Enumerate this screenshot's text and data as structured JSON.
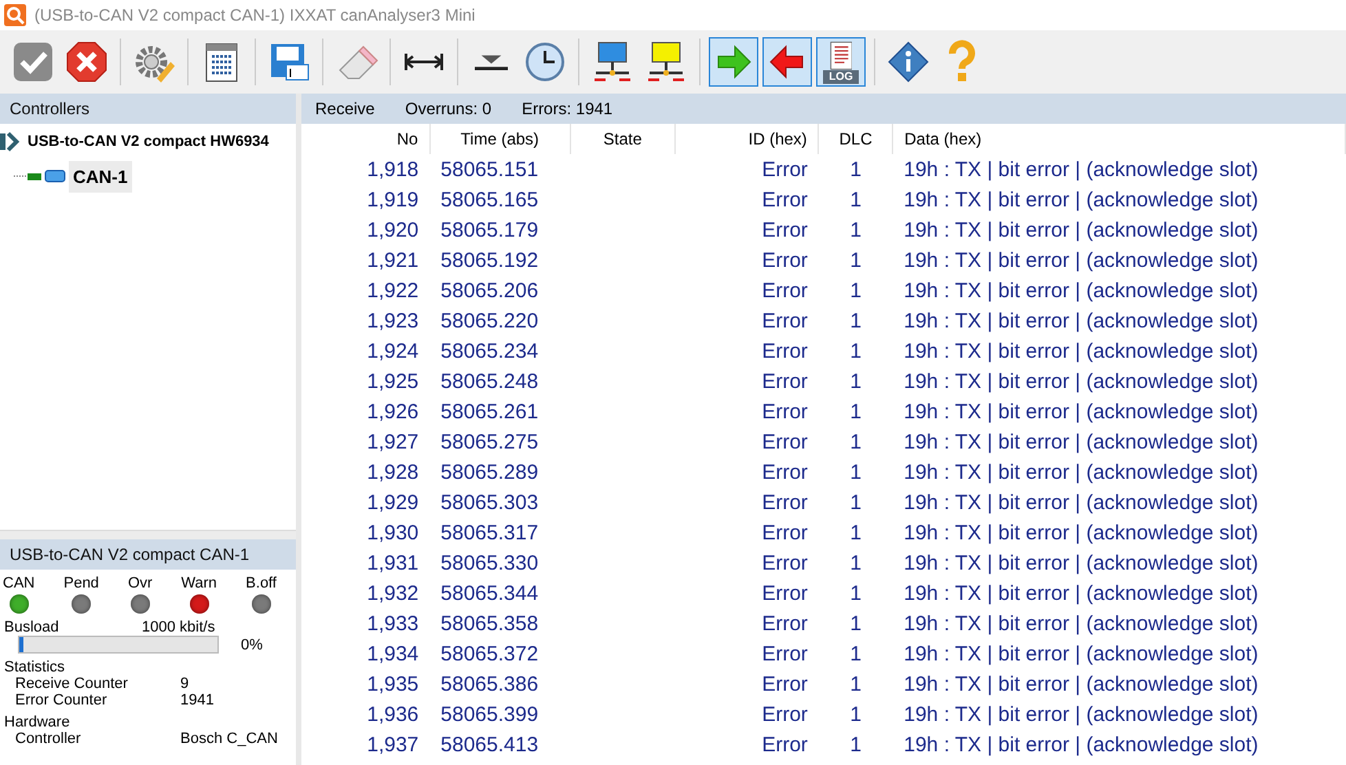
{
  "window": {
    "title": "(USB-to-CAN V2 compact  CAN-1) IXXAT canAnalyser3 Mini"
  },
  "toolbar": [
    {
      "kind": "check",
      "pressed": false
    },
    {
      "kind": "cancel",
      "pressed": false
    },
    {
      "kind": "gear",
      "pressed": false,
      "sep_before": true
    },
    {
      "kind": "list",
      "pressed": false,
      "sep_before": true
    },
    {
      "kind": "save",
      "pressed": false,
      "sep_before": true
    },
    {
      "kind": "eraser",
      "pressed": false,
      "sep_before": true
    },
    {
      "kind": "width",
      "pressed": false,
      "sep_before": true
    },
    {
      "kind": "trigger",
      "pressed": false,
      "sep_before": true
    },
    {
      "kind": "clock",
      "pressed": false
    },
    {
      "kind": "net-blue",
      "pressed": false,
      "sep_before": true
    },
    {
      "kind": "net-yellow",
      "pressed": false
    },
    {
      "kind": "arrow-right",
      "pressed": true,
      "sep_before": true
    },
    {
      "kind": "arrow-left",
      "pressed": true
    },
    {
      "kind": "log",
      "pressed": true,
      "label": "LOG"
    },
    {
      "kind": "info",
      "pressed": false,
      "sep_before": true
    },
    {
      "kind": "help",
      "pressed": false
    }
  ],
  "controllers": {
    "title": "Controllers",
    "tree": [
      {
        "label": "USB-to-CAN V2 compact  HW6934",
        "expanded": true,
        "children": [
          {
            "label": "CAN-1",
            "selected": true
          }
        ]
      }
    ]
  },
  "device": {
    "title": "USB-to-CAN V2 compact  CAN-1",
    "leds": [
      {
        "label": "CAN",
        "color": "#3fae2a"
      },
      {
        "label": "Pend",
        "color": "#7a7a7a"
      },
      {
        "label": "Ovr",
        "color": "#7a7a7a"
      },
      {
        "label": "Warn",
        "color": "#d41a1a"
      },
      {
        "label": "B.off",
        "color": "#7a7a7a"
      }
    ],
    "busload": {
      "label": "Busload",
      "bitrate": "1000 kbit/s",
      "level": 0,
      "reading": "0%"
    },
    "statistics": {
      "title": "Statistics",
      "rows": [
        {
          "label": "Receive Counter",
          "value": "9"
        },
        {
          "label": "Error Counter",
          "value": "1941"
        }
      ]
    },
    "hardware": {
      "title": "Hardware",
      "rows": [
        {
          "label": "Controller",
          "value": "Bosch C_CAN"
        }
      ]
    }
  },
  "receive": {
    "title": "Receive",
    "overruns": "Overruns: 0",
    "errors": "Errors: 1941",
    "columns": [
      "No",
      "Time (abs)",
      "State",
      "ID (hex)",
      "DLC",
      "Data (hex)"
    ],
    "rows": [
      [
        "1,918",
        "58065.151",
        "",
        "Error",
        "1",
        "19h : TX | bit error | (acknowledge slot)"
      ],
      [
        "1,919",
        "58065.165",
        "",
        "Error",
        "1",
        "19h : TX | bit error | (acknowledge slot)"
      ],
      [
        "1,920",
        "58065.179",
        "",
        "Error",
        "1",
        "19h : TX | bit error | (acknowledge slot)"
      ],
      [
        "1,921",
        "58065.192",
        "",
        "Error",
        "1",
        "19h : TX | bit error | (acknowledge slot)"
      ],
      [
        "1,922",
        "58065.206",
        "",
        "Error",
        "1",
        "19h : TX | bit error | (acknowledge slot)"
      ],
      [
        "1,923",
        "58065.220",
        "",
        "Error",
        "1",
        "19h : TX | bit error | (acknowledge slot)"
      ],
      [
        "1,924",
        "58065.234",
        "",
        "Error",
        "1",
        "19h : TX | bit error | (acknowledge slot)"
      ],
      [
        "1,925",
        "58065.248",
        "",
        "Error",
        "1",
        "19h : TX | bit error | (acknowledge slot)"
      ],
      [
        "1,926",
        "58065.261",
        "",
        "Error",
        "1",
        "19h : TX | bit error | (acknowledge slot)"
      ],
      [
        "1,927",
        "58065.275",
        "",
        "Error",
        "1",
        "19h : TX | bit error | (acknowledge slot)"
      ],
      [
        "1,928",
        "58065.289",
        "",
        "Error",
        "1",
        "19h : TX | bit error | (acknowledge slot)"
      ],
      [
        "1,929",
        "58065.303",
        "",
        "Error",
        "1",
        "19h : TX | bit error | (acknowledge slot)"
      ],
      [
        "1,930",
        "58065.317",
        "",
        "Error",
        "1",
        "19h : TX | bit error | (acknowledge slot)"
      ],
      [
        "1,931",
        "58065.330",
        "",
        "Error",
        "1",
        "19h : TX | bit error | (acknowledge slot)"
      ],
      [
        "1,932",
        "58065.344",
        "",
        "Error",
        "1",
        "19h : TX | bit error | (acknowledge slot)"
      ],
      [
        "1,933",
        "58065.358",
        "",
        "Error",
        "1",
        "19h : TX | bit error | (acknowledge slot)"
      ],
      [
        "1,934",
        "58065.372",
        "",
        "Error",
        "1",
        "19h : TX | bit error | (acknowledge slot)"
      ],
      [
        "1,935",
        "58065.386",
        "",
        "Error",
        "1",
        "19h : TX | bit error | (acknowledge slot)"
      ],
      [
        "1,936",
        "58065.399",
        "",
        "Error",
        "1",
        "19h : TX | bit error | (acknowledge slot)"
      ],
      [
        "1,937",
        "58065.413",
        "",
        "Error",
        "1",
        "19h : TX | bit error | (acknowledge slot)"
      ]
    ]
  }
}
